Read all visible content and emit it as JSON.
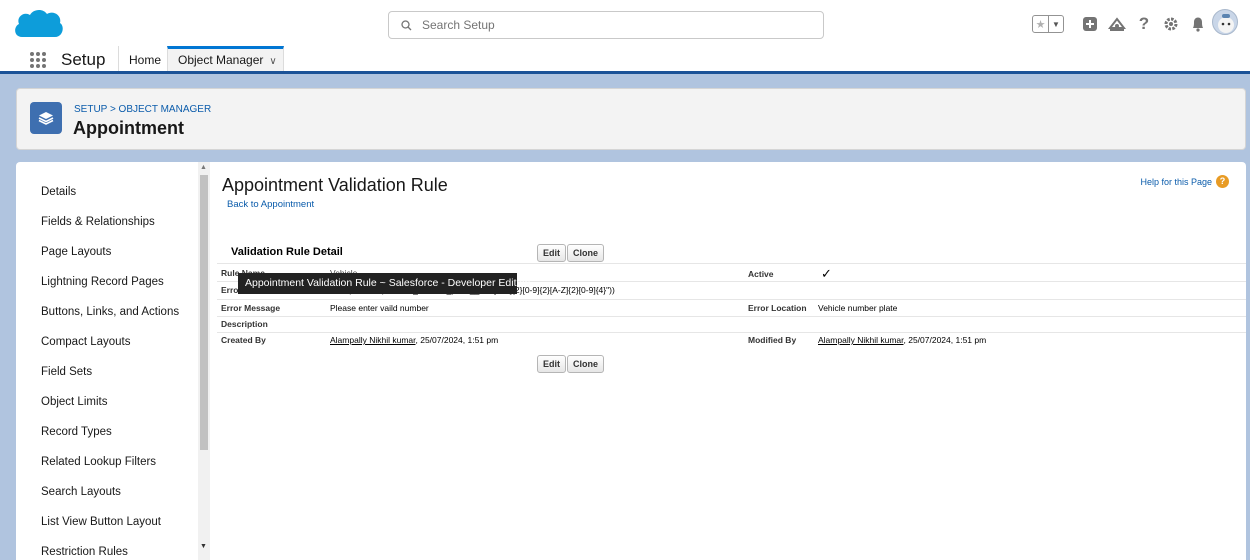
{
  "header": {
    "search_placeholder": "Search Setup",
    "icons": [
      "favorites-star-icon",
      "favorites-dropdown-icon",
      "global-actions-icon",
      "trailhead-icon",
      "help-icon",
      "setup-gear-icon",
      "notifications-bell-icon",
      "user-avatar"
    ]
  },
  "nav": {
    "app_name": "Setup",
    "home": "Home",
    "object_manager": "Object Manager"
  },
  "object_header": {
    "breadcrumb": "SETUP > OBJECT MANAGER",
    "title": "Appointment"
  },
  "sidebar": {
    "items": [
      {
        "label": "Details"
      },
      {
        "label": "Fields & Relationships"
      },
      {
        "label": "Page Layouts"
      },
      {
        "label": "Lightning Record Pages"
      },
      {
        "label": "Buttons, Links, and Actions"
      },
      {
        "label": "Compact Layouts"
      },
      {
        "label": "Field Sets"
      },
      {
        "label": "Object Limits"
      },
      {
        "label": "Record Types"
      },
      {
        "label": "Related Lookup Filters"
      },
      {
        "label": "Search Layouts"
      },
      {
        "label": "List View Button Layout"
      },
      {
        "label": "Restriction Rules"
      }
    ]
  },
  "content": {
    "page_title": "Appointment Validation Rule",
    "back_link": "Back to Appointment",
    "help_link": "Help for this Page",
    "section_title": "Validation Rule Detail",
    "edit": "Edit",
    "clone": "Clone",
    "rule_name_label": "Rule Name",
    "rule_name_value": "Vehicle",
    "error_formula_label": "Error Condition Formula",
    "error_formula_value": "NOT(REGEX( Vehicle_number_plate__c , \"[A-Z]{2}[0-9]{2}[A-Z]{2}[0-9]{4}\"))",
    "active_label": "Active",
    "active_value": "✓",
    "error_message_label": "Error Message",
    "error_message_value": "Please enter vaild number",
    "error_location_label": "Error Location",
    "error_location_value": "Vehicle number plate",
    "description_label": "Description",
    "created_by_label": "Created By",
    "created_by_name": "Alampally Nikhil kumar",
    "created_by_date": ", 25/07/2024, 1:51 pm",
    "modified_by_label": "Modified By",
    "modified_by_name": "Alampally Nikhil kumar",
    "modified_by_date": ", 25/07/2024, 1:51 pm"
  },
  "tooltip": "Appointment Validation Rule ~ Salesforce - Developer Edition",
  "colors": {
    "brand_blue": "#0176d3",
    "link_blue": "#0b5cab",
    "banner_blue": "#1b5297",
    "object_icon": "#3e6fb0",
    "help_orange": "#e89b24"
  }
}
